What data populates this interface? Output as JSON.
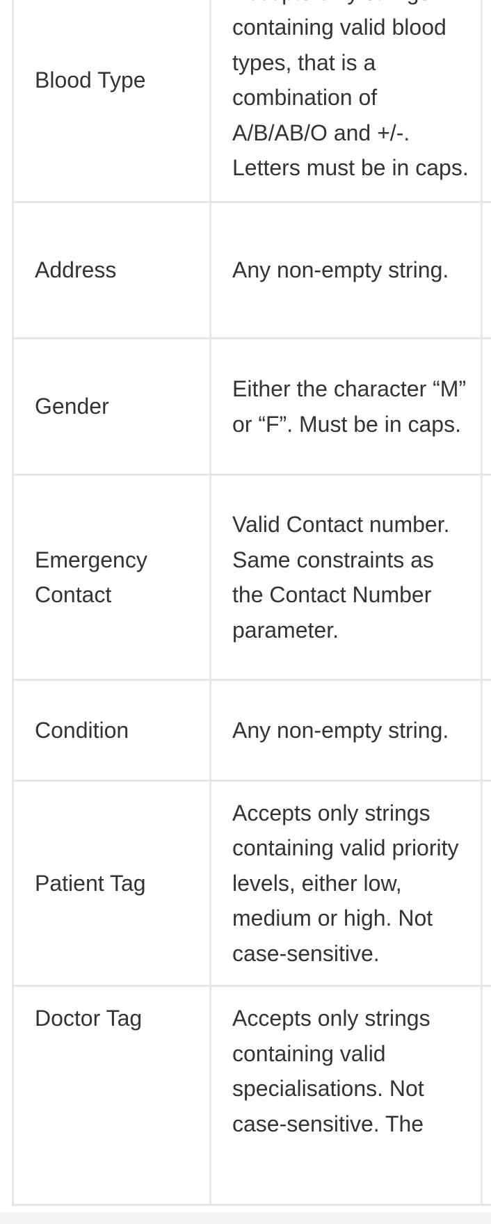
{
  "rows": [
    {
      "param": "Blood Type",
      "desc": "Accepts only strings containing valid blood types, that is a combination of A/B/AB/O and +/-. Letters must be in caps."
    },
    {
      "param": "Address",
      "desc": "Any non-empty string."
    },
    {
      "param": "Gender",
      "desc": "Either the character “M” or “F”. Must be in caps."
    },
    {
      "param": "Emergency Contact",
      "desc": "Valid Contact number. Same constraints as the Contact Number parameter."
    },
    {
      "param": "Condition",
      "desc": "Any non-empty string."
    },
    {
      "param": "Patient Tag",
      "desc": "Accepts only strings containing valid priority levels, either low, medium or high. Not case-sensitive."
    },
    {
      "param": "Doctor Tag",
      "desc": "Accepts only strings containing valid specialisations. Not case-sensitive. The"
    }
  ],
  "colors": {
    "text": "#333333",
    "border": "#e6e6e6",
    "background": "#ffffff",
    "bottom_strip": "#f4f4f4"
  }
}
